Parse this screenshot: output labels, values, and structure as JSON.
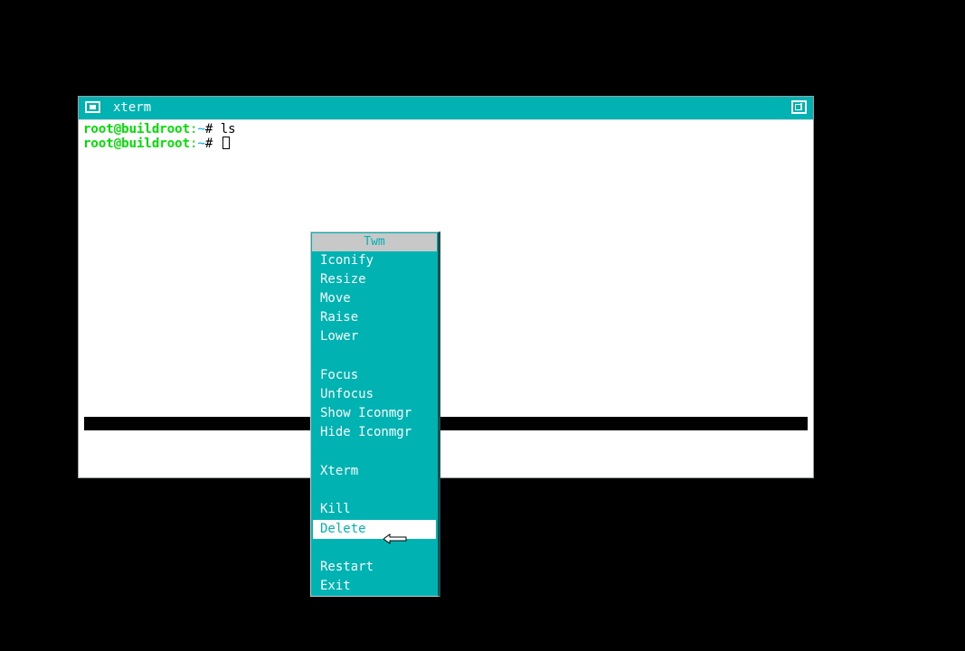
{
  "colors": {
    "desktop": "#000000",
    "titlebar": "#00b3b3",
    "menu_bg": "#00b3b3",
    "menu_title_bg": "#c8c8c8",
    "prompt_user": "#00e000",
    "prompt_path": "#00a0ff"
  },
  "window": {
    "title": "xterm",
    "icon": "window-icon",
    "resize_icon": "resize-icon"
  },
  "terminal": {
    "lines": [
      {
        "user": "root@buildroot",
        "sep": ":",
        "path": "~",
        "hash": "#",
        "command": " ls"
      },
      {
        "user": "root@buildroot",
        "sep": ":",
        "path": "~",
        "hash": "#",
        "command": " "
      }
    ]
  },
  "menu": {
    "title": "Twm",
    "items": [
      {
        "label": "Iconify"
      },
      {
        "label": "Resize"
      },
      {
        "label": "Move"
      },
      {
        "label": "Raise"
      },
      {
        "label": "Lower"
      },
      {
        "label": "Focus"
      },
      {
        "label": "Unfocus"
      },
      {
        "label": "Show Iconmgr"
      },
      {
        "label": "Hide Iconmgr"
      },
      {
        "label": "Xterm"
      },
      {
        "label": "Kill"
      },
      {
        "label": "Delete",
        "selected": true
      },
      {
        "label": "Restart"
      },
      {
        "label": "Exit"
      }
    ]
  },
  "pointer": {
    "icon": "arrow-pointer-icon"
  }
}
